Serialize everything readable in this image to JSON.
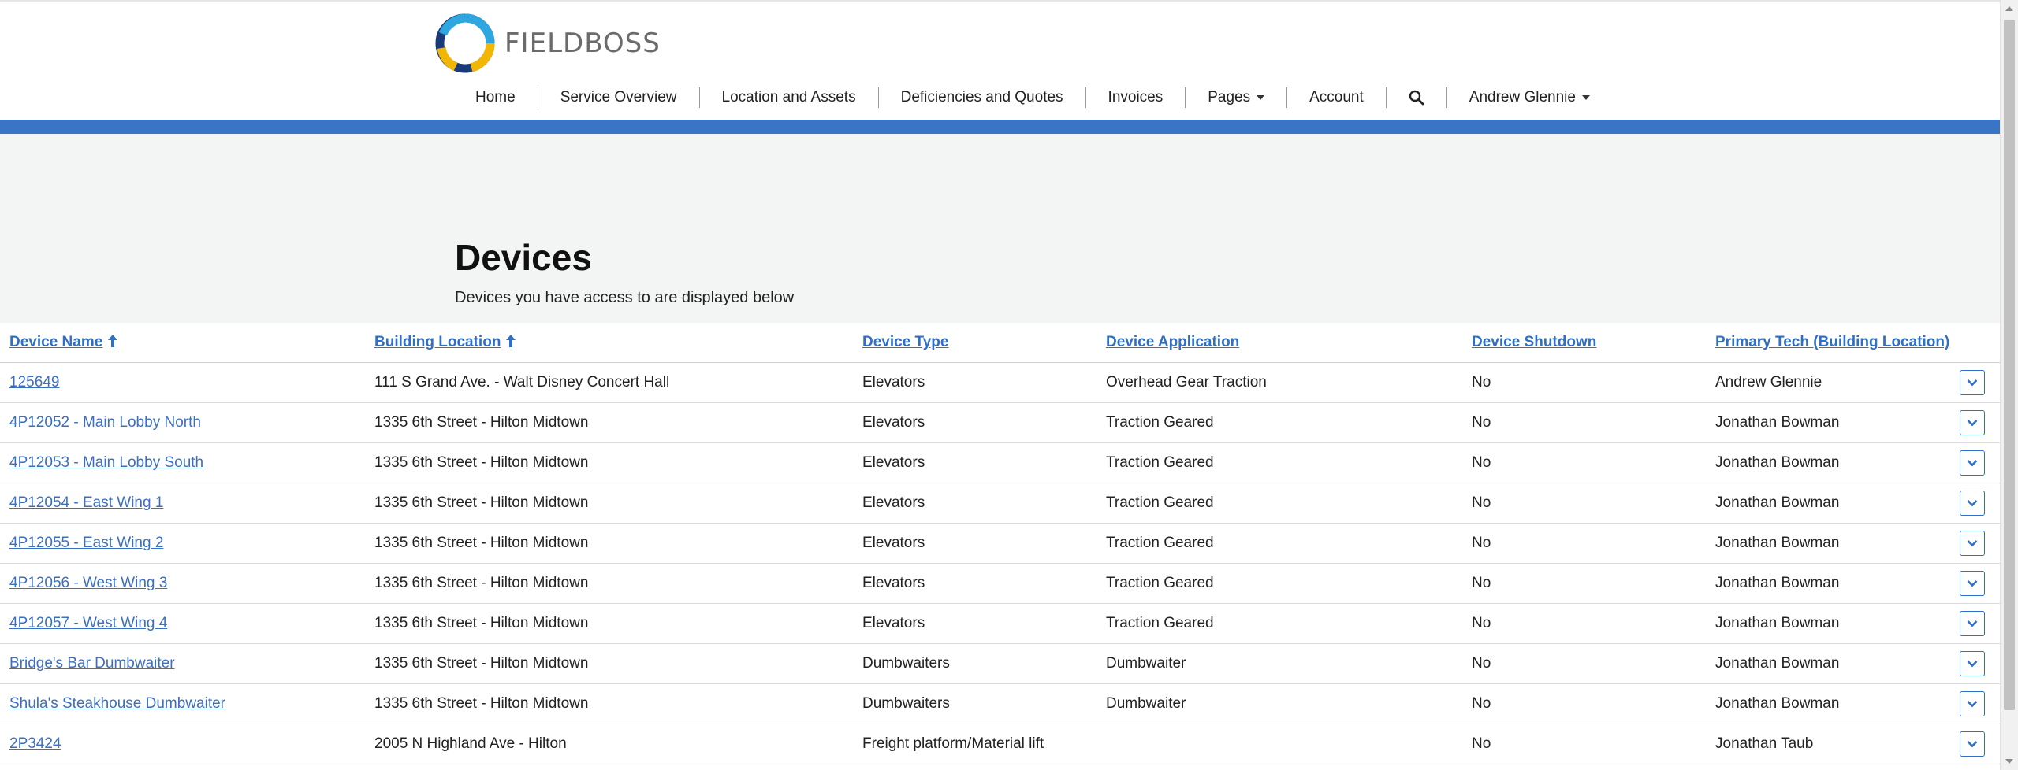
{
  "brand": {
    "name": "FIELDBOSS"
  },
  "nav": {
    "items": [
      {
        "label": "Home"
      },
      {
        "label": "Service Overview"
      },
      {
        "label": "Location and Assets"
      },
      {
        "label": "Deficiencies and Quotes"
      },
      {
        "label": "Invoices"
      },
      {
        "label": "Pages"
      },
      {
        "label": "Account"
      },
      {
        "label": "Andrew Glennie"
      }
    ],
    "search_icon": "search-icon"
  },
  "page": {
    "title": "Devices",
    "subtitle": "Devices you have access to are displayed below"
  },
  "table": {
    "columns": [
      {
        "label": "Device Name",
        "sorted": "asc"
      },
      {
        "label": "Building Location",
        "sorted": "asc"
      },
      {
        "label": "Device Type"
      },
      {
        "label": "Device Application"
      },
      {
        "label": "Device Shutdown"
      },
      {
        "label": "Primary Tech (Building Location)"
      }
    ],
    "rows": [
      {
        "name": "125649",
        "location": "111 S Grand Ave. - Walt Disney Concert Hall",
        "type": "Elevators",
        "application": "Overhead Gear Traction",
        "shutdown": "No",
        "tech": "Andrew Glennie"
      },
      {
        "name": "4P12052 - Main Lobby North",
        "location": "1335 6th Street - Hilton Midtown",
        "type": "Elevators",
        "application": "Traction Geared",
        "shutdown": "No",
        "tech": "Jonathan Bowman"
      },
      {
        "name": "4P12053 - Main Lobby South",
        "location": "1335 6th Street - Hilton Midtown",
        "type": "Elevators",
        "application": "Traction Geared",
        "shutdown": "No",
        "tech": "Jonathan Bowman"
      },
      {
        "name": "4P12054 - East Wing 1",
        "location": "1335 6th Street - Hilton Midtown",
        "type": "Elevators",
        "application": "Traction Geared",
        "shutdown": "No",
        "tech": "Jonathan Bowman"
      },
      {
        "name": "4P12055 - East Wing 2",
        "location": "1335 6th Street - Hilton Midtown",
        "type": "Elevators",
        "application": "Traction Geared",
        "shutdown": "No",
        "tech": "Jonathan Bowman"
      },
      {
        "name": "4P12056 - West Wing 3",
        "location": "1335 6th Street - Hilton Midtown",
        "type": "Elevators",
        "application": "Traction Geared",
        "shutdown": "No",
        "tech": "Jonathan Bowman"
      },
      {
        "name": "4P12057 - West Wing 4",
        "location": "1335 6th Street - Hilton Midtown",
        "type": "Elevators",
        "application": "Traction Geared",
        "shutdown": "No",
        "tech": "Jonathan Bowman"
      },
      {
        "name": "Bridge's Bar Dumbwaiter",
        "location": "1335 6th Street - Hilton Midtown",
        "type": "Dumbwaiters",
        "application": "Dumbwaiter",
        "shutdown": "No",
        "tech": "Jonathan Bowman"
      },
      {
        "name": "Shula's Steakhouse Dumbwaiter",
        "location": "1335 6th Street - Hilton Midtown",
        "type": "Dumbwaiters",
        "application": "Dumbwaiter",
        "shutdown": "No",
        "tech": "Jonathan Bowman"
      },
      {
        "name": "2P3424",
        "location": "2005 N Highland Ave - Hilton",
        "type": "Freight platform/Material lift",
        "application": "",
        "shutdown": "No",
        "tech": "Jonathan Taub"
      }
    ]
  },
  "colors": {
    "accent": "#3a74c4",
    "link": "#2f6fc5",
    "hero_bg": "#f3f4f4"
  }
}
